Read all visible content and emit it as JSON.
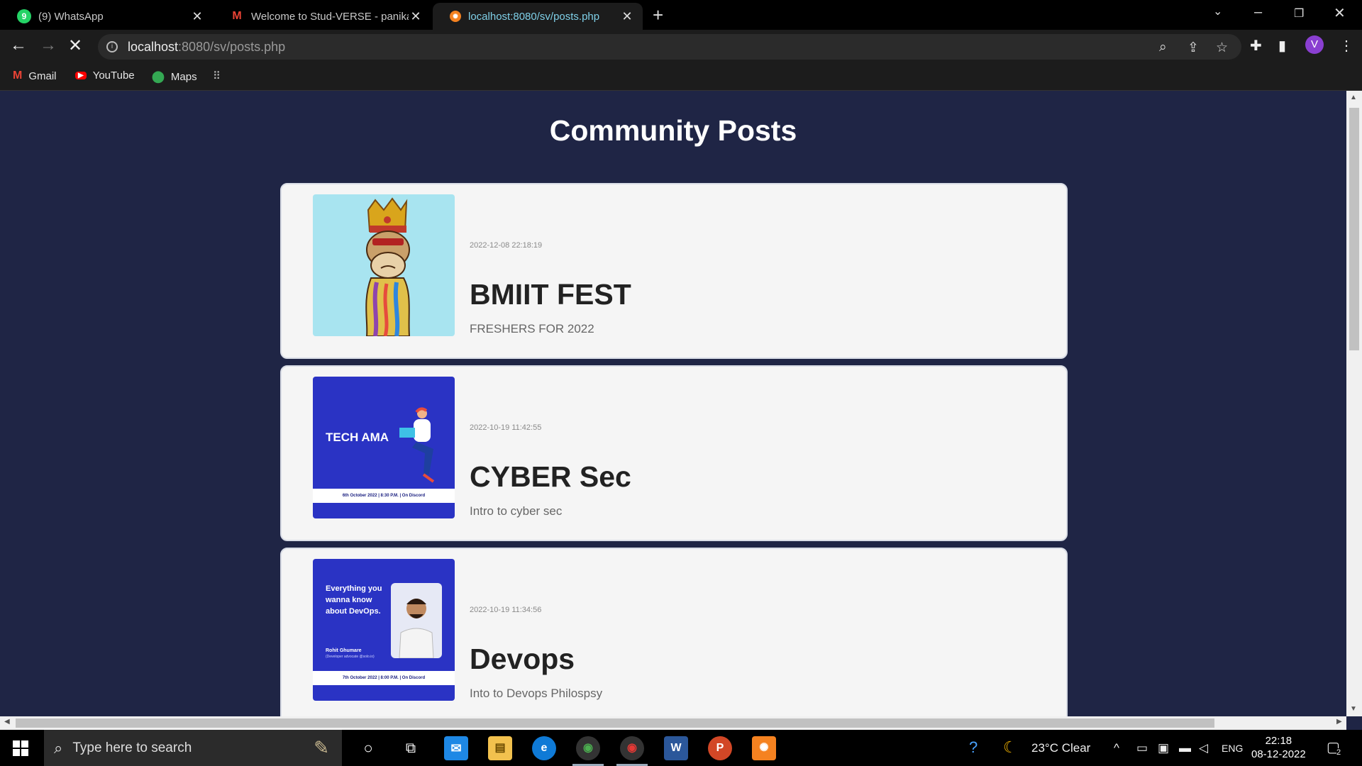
{
  "browser": {
    "tabs": [
      {
        "label": "(9) WhatsApp",
        "icon": "whatsapp-icon"
      },
      {
        "label": "Welcome to Stud-VERSE - panika",
        "icon": "gmail-icon"
      },
      {
        "label": "localhost:8080/sv/posts.php",
        "icon": "xampp-icon",
        "active": true
      }
    ],
    "url_host": "localhost",
    "url_path": ":8080/sv/posts.php",
    "profile_initial": "V",
    "bookmarks": [
      {
        "label": "Gmail",
        "icon": "gmail-icon"
      },
      {
        "label": "YouTube",
        "icon": "youtube-icon"
      },
      {
        "label": "Maps",
        "icon": "maps-icon"
      }
    ]
  },
  "page": {
    "title": "Community Posts",
    "posts": [
      {
        "date": "2022-12-08 22:18:19",
        "title": "BMIIT FEST",
        "description": "FRESHERS FOR 2022",
        "image": "ape-with-crown-image"
      },
      {
        "date": "2022-10-19 11:42:55",
        "title": "CYBER Sec",
        "description": "Intro to cyber sec",
        "image": "tech-ama-poster-image",
        "poster": {
          "heading": "TECH AMA",
          "footer": "6th October 2022  |  8:30 P.M.  |  On Discord"
        }
      },
      {
        "date": "2022-10-19 11:34:56",
        "title": "Devops",
        "description": "Into to Devops Philospsy",
        "image": "devops-poster-image",
        "poster": {
          "heading": "Everything you wanna know about DevOps.",
          "speaker": "Rohit Ghumare",
          "speaker_role": "(Developer advocate @solo.io)",
          "footer": "7th October 2022  |  8:00 P.M.  |  On Discord"
        }
      }
    ]
  },
  "taskbar": {
    "search_placeholder": "Type here to search",
    "weather": "23°C  Clear",
    "language": "ENG",
    "time": "22:18",
    "date": "08-12-2022",
    "notifications": "2"
  },
  "colors": {
    "page_bg": "#1f2545",
    "card_bg": "#f5f5f5",
    "poster_blue": "#2a33c4",
    "ape_bg": "#a8e4f0"
  }
}
